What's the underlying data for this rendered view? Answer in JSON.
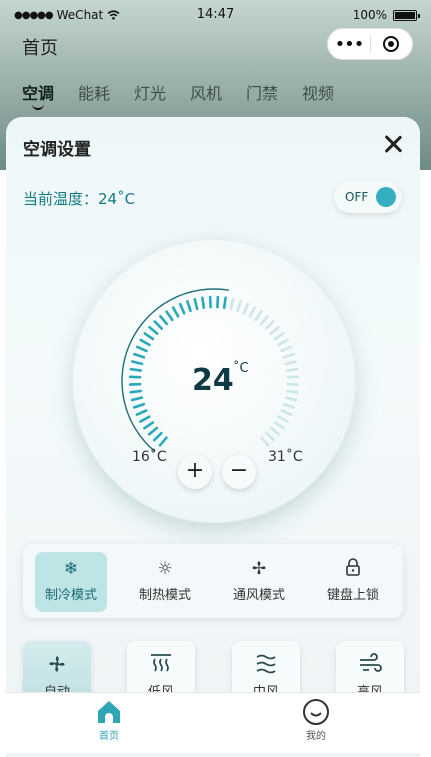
{
  "status_bar": {
    "carrier": "WeChat",
    "time": "14:47",
    "battery": "100%"
  },
  "nav": {
    "title": "首页",
    "capsule_more": "•••"
  },
  "tabs": [
    {
      "label": "空调",
      "active": true
    },
    {
      "label": "能耗"
    },
    {
      "label": "灯光"
    },
    {
      "label": "风机"
    },
    {
      "label": "门禁"
    },
    {
      "label": "视频"
    }
  ],
  "panel": {
    "title": "空调设置",
    "current_temp_label": "当前温度：24˚C",
    "power_toggle": {
      "label": "OFF"
    },
    "dial": {
      "value": "24",
      "unit": "˚C",
      "min_label": "16˚C",
      "max_label": "31˚C",
      "min": 16,
      "max": 31,
      "current": 24
    },
    "plus_label": "+",
    "minus_label": "−"
  },
  "modes": [
    {
      "label": "制冷模式",
      "icon": "snowflake-icon",
      "glyph": "❄",
      "active": true
    },
    {
      "label": "制热模式",
      "icon": "sun-icon",
      "glyph": "☼"
    },
    {
      "label": "通风模式",
      "icon": "fan-icon",
      "glyph": "✢"
    },
    {
      "label": "键盘上锁",
      "icon": "lock-icon",
      "glyph": "🔒"
    }
  ],
  "fan_speeds": [
    {
      "label": "自动",
      "icon": "fan-icon",
      "active": true
    },
    {
      "label": "低风",
      "icon": "low-wind-icon"
    },
    {
      "label": "中风",
      "icon": "medium-wind-icon"
    },
    {
      "label": "高风",
      "icon": "high-wind-icon"
    }
  ],
  "tabbar": [
    {
      "label": "首页",
      "icon": "home-icon",
      "active": true
    },
    {
      "label": "我的",
      "icon": "profile-icon"
    }
  ],
  "colors": {
    "accent": "#2ea6b6",
    "dial_dark": "#0f3a44",
    "mode_active_bg": "#bfe4e6"
  }
}
